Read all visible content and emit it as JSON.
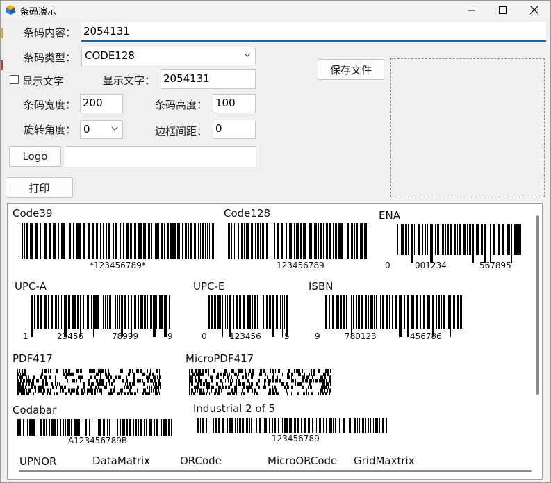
{
  "window": {
    "title": "条码演示",
    "minimize_label": "─",
    "maximize_label": "☐",
    "close_label": "✕"
  },
  "form": {
    "content_label": "条码内容：",
    "content_value": "2054131",
    "type_label": "条码类型：",
    "type_value": "CODE128",
    "show_text_label": "显示文字",
    "show_text_checked": false,
    "display_text_label": "显示文字：",
    "display_text_value": "2054131",
    "width_label": "条码宽度：",
    "width_value": "200",
    "height_label": "条码高度：",
    "height_value": "100",
    "rotation_label": "旋转角度：",
    "rotation_value": "0",
    "margin_label": "边框间距：",
    "margin_value": "0",
    "logo_button": "Logo",
    "logo_path": "",
    "save_button": "保存文件",
    "print_button": "打印"
  },
  "gallery": [
    {
      "name": "Code39",
      "text": [
        "*123456789*"
      ]
    },
    {
      "name": "Code128",
      "text": [
        "123456789"
      ]
    },
    {
      "name": "ENA",
      "text": [
        "0",
        "001234",
        "567895"
      ]
    },
    {
      "name": "UPC-A",
      "text": [
        "1",
        "23456",
        "78999",
        "9"
      ]
    },
    {
      "name": "UPC-E",
      "text": [
        "0",
        "123456",
        "5"
      ]
    },
    {
      "name": "ISBN",
      "text": [
        "9",
        "780123",
        "456786"
      ]
    },
    {
      "name": "PDF417",
      "text": []
    },
    {
      "name": "MicroPDF417",
      "text": []
    },
    {
      "name": "Codabar",
      "text": [
        "A123456789B"
      ]
    },
    {
      "name": "Industrial 2 of 5",
      "text": [
        "123456789"
      ]
    },
    {
      "name": "UPNOR",
      "text": []
    },
    {
      "name": "DataMatrix",
      "text": []
    },
    {
      "name": "ORCode",
      "text": []
    },
    {
      "name": "MicroORCode",
      "text": []
    },
    {
      "name": "GridMaxtrix",
      "text": []
    }
  ],
  "colors": {
    "accent": "#0067c0",
    "window_bg": "#f0f0f0",
    "panel_bg": "#ffffff"
  }
}
